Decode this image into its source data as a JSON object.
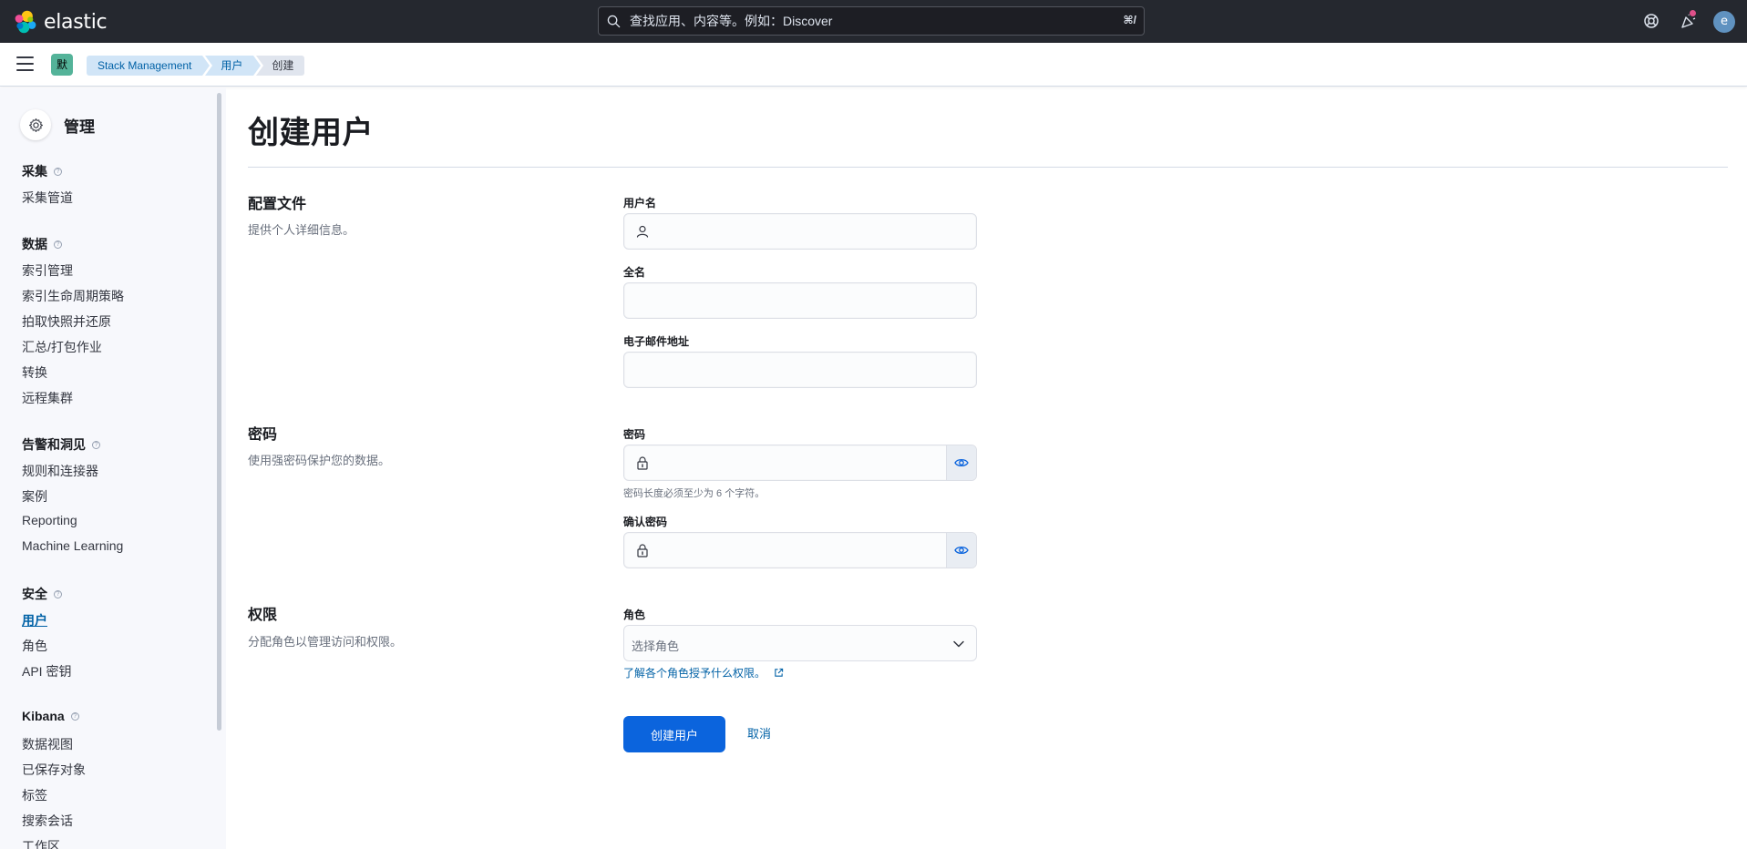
{
  "header": {
    "brand": "elastic",
    "search_placeholder": "查找应用、内容等。例如：Discover",
    "search_shortcut": "⌘/",
    "avatar_initial": "e"
  },
  "breadcrumbs": {
    "space_badge": "默",
    "items": [
      "Stack Management",
      "用户",
      "创建"
    ]
  },
  "sidebar": {
    "title": "管理",
    "sections": [
      {
        "title": "采集",
        "items": [
          "采集管道"
        ]
      },
      {
        "title": "数据",
        "items": [
          "索引管理",
          "索引生命周期策略",
          "拍取快照并还原",
          "汇总/打包作业",
          "转换",
          "远程集群"
        ]
      },
      {
        "title": "告警和洞见",
        "items": [
          "规则和连接器",
          "案例",
          "Reporting",
          "Machine Learning"
        ]
      },
      {
        "title": "安全",
        "items": [
          "用户",
          "角色",
          "API 密钥"
        ]
      },
      {
        "title": "Kibana",
        "items": [
          "数据视图",
          "已保存对象",
          "标签",
          "搜索会话",
          "工作区"
        ]
      }
    ],
    "active_item": "用户"
  },
  "main": {
    "title": "创建用户",
    "profile": {
      "title": "配置文件",
      "desc": "提供个人详细信息。",
      "username_label": "用户名",
      "fullname_label": "全名",
      "email_label": "电子邮件地址",
      "username_value": "",
      "fullname_value": "",
      "email_value": ""
    },
    "password": {
      "title": "密码",
      "desc": "使用强密码保护您的数据。",
      "password_label": "密码",
      "password_help": "密码长度必须至少为 6 个字符。",
      "confirm_label": "确认密码",
      "password_value": "",
      "confirm_value": ""
    },
    "privileges": {
      "title": "权限",
      "desc": "分配角色以管理访问和权限。",
      "roles_label": "角色",
      "roles_placeholder": "选择角色",
      "roles_link": "了解各个角色授予什么权限。"
    },
    "actions": {
      "create_label": "创建用户",
      "cancel_label": "取消"
    }
  },
  "colors": {
    "header_bg": "#25282f",
    "primary": "#0b64dd",
    "link": "#0061a6",
    "sidebar_bg": "#f7f8fc"
  },
  "icons": {
    "logo": "elastic-logo-icon",
    "search": "search-icon",
    "help": "help-lifebuoy-icon",
    "news": "newsfeed-cheer-icon",
    "settings": "gear-icon",
    "user": "user-icon",
    "lock": "lock-icon",
    "eye": "eye-icon",
    "chevron": "chevron-down-icon",
    "external": "external-link-icon"
  }
}
